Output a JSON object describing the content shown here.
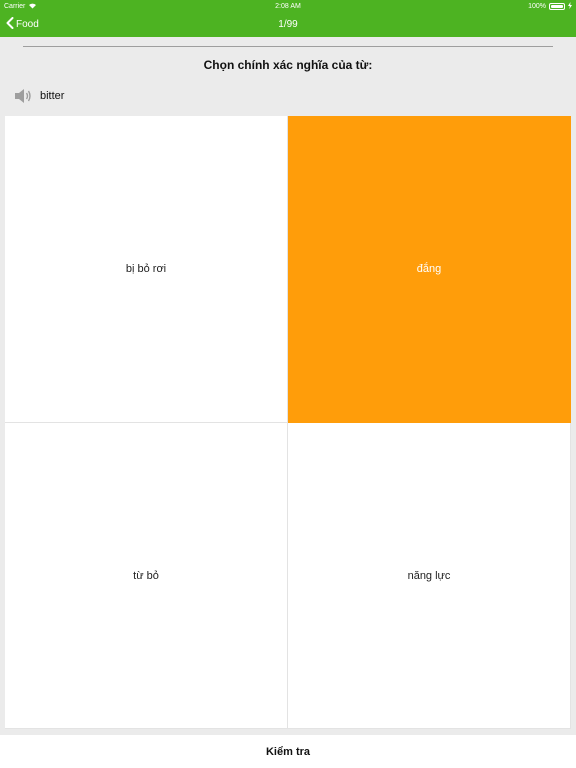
{
  "status_bar": {
    "carrier": "Carrier",
    "time": "2:08 AM",
    "battery": "100%",
    "battery_level": 1.0,
    "icons": [
      "wifi-icon",
      "battery-icon",
      "charging-icon"
    ]
  },
  "nav": {
    "back_label": "Food",
    "title": "1/99",
    "back_icon": "chevron-left-icon"
  },
  "question": "Chọn chính xác nghĩa của từ:",
  "word": {
    "text": "bitter",
    "icon": "speaker-icon"
  },
  "answers": [
    {
      "label": "bị bỏ rơi",
      "selected": false
    },
    {
      "label": "đắng",
      "selected": true
    },
    {
      "label": "từ bỏ",
      "selected": false
    },
    {
      "label": "năng lực",
      "selected": false
    }
  ],
  "check_button": "Kiểm tra",
  "colors": {
    "nav_green": "#4db322",
    "selected_orange": "#ff9d0a",
    "background": "#ebebeb"
  }
}
